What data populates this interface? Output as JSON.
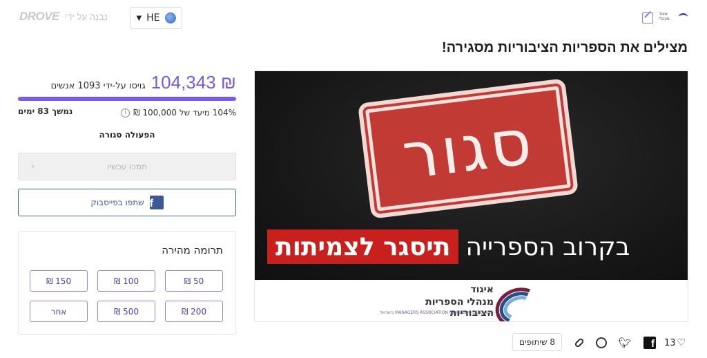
{
  "header": {
    "brand_name": "DROVE",
    "powered_by": "נבנה על ידי",
    "language": "HE",
    "org_logo_text": "איגוד מנהלי"
  },
  "campaign": {
    "title": "מצילים את הספריות הציבוריות מסגירה!",
    "hero": {
      "stamp_text": "סגור",
      "banner_red": "תיסגר לצמיתות",
      "banner_white": "בקרוב הספרייה",
      "assoc_line1": "איגוד",
      "assoc_line2": "מנהלי הספריות הציבוריות",
      "assoc_line3": "MANAGERS ASSOCIATION OF PUBLIC LIBRARIES בישראל"
    }
  },
  "funding": {
    "amount": "₪ 104,343",
    "raised_by": "גויסו על-ידי 1093 אנשים",
    "progress_fraction": 1.0,
    "goal_text": "104% מיעד של 100,000 ₪",
    "remaining": "נמשך 83 ימים",
    "status": "הפעולה סגורה",
    "donate_label": "תמכו עכשיו",
    "facebook_share_label": "שתפו בפייסבוק"
  },
  "quick_donation": {
    "title": "תרומה מהירה",
    "amounts": [
      "50 ₪",
      "100 ₪",
      "150 ₪",
      "200 ₪",
      "500 ₪",
      "אחר"
    ]
  },
  "share_bar": {
    "shares_label": "8 שיתופים",
    "likes_count": "13"
  },
  "colors": {
    "accent": "#7b5bea",
    "facebook": "#3b5998",
    "stamp_red": "#c13b34",
    "banner_red": "#c8211d"
  }
}
